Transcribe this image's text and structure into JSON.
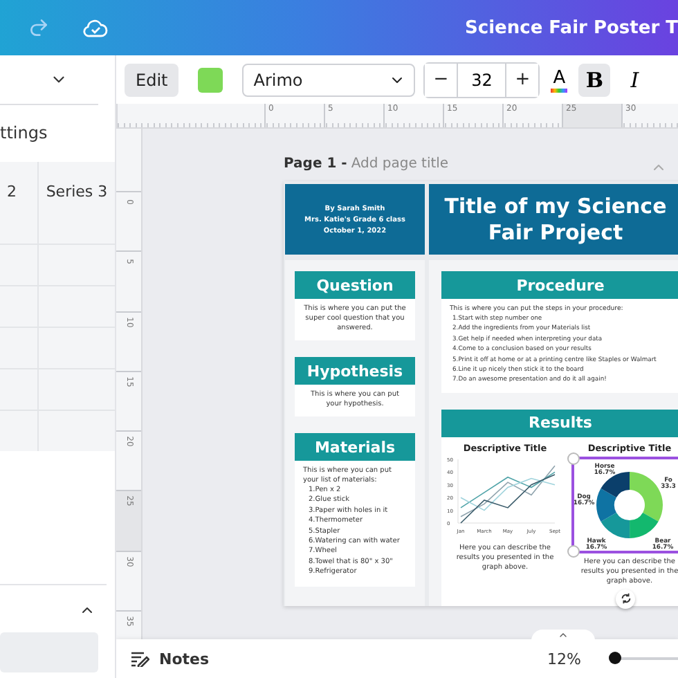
{
  "header": {
    "title": "Science Fair Poster T"
  },
  "left_panel": {
    "settings_label": "ttings",
    "table": {
      "columns": [
        "2",
        "Series 3"
      ]
    }
  },
  "toolbar": {
    "edit": "Edit",
    "color": "#7ed957",
    "font": "Arimo",
    "decrease": "−",
    "size": "32",
    "increase": "+",
    "text_color": "A",
    "styles": [
      {
        "label": "B",
        "kind": "bold",
        "selected": true
      },
      {
        "label": "I",
        "kind": "italic",
        "selected": false
      }
    ]
  },
  "rulers": {
    "horizontal": [
      "0",
      "5",
      "10",
      "15",
      "20",
      "25",
      "30"
    ],
    "vertical": [
      "0",
      "5",
      "10",
      "15",
      "20",
      "25",
      "30",
      "35"
    ]
  },
  "page": {
    "label": "Page 1 -",
    "title_placeholder": "Add page title"
  },
  "poster": {
    "byline": [
      "By Sarah Smith",
      "Mrs. Katie's Grade 6 class",
      "October 1, 2022"
    ],
    "title": "Title of my Science Fair Project",
    "left_sections": [
      {
        "heading": "Question",
        "text": "This is where you can put the super cool question that you answered."
      },
      {
        "heading": "Hypothesis",
        "text": "This is where you can put your hypothesis."
      },
      {
        "heading": "Materials",
        "text": "This is where you can put your list of materials:",
        "items": [
          "1.Pen x 2",
          "2.Glue stick",
          "3.Paper with holes in it",
          "4.Thermometer",
          "5.Stapler",
          "6.Watering can with water",
          "7.Wheel",
          "8.Towel that is 80\" x 30\"",
          "9.Refrigerator"
        ]
      }
    ],
    "procedure": {
      "heading": "Procedure",
      "text": "This is where you can put the steps in your procedure:",
      "items": [
        "1.Start with step number one",
        "2.Add the ingredients from your Materials list",
        "3.Get help if needed when interpreting your data",
        "4.Come to a conclusion based on your results",
        "5.Print it off at home or at a printing centre like Staples or Walmart",
        "6.Line it up nicely then stick it to the board",
        "7.Do an awesome presentation and do it all again!"
      ]
    },
    "results": {
      "heading": "Results",
      "charts": [
        {
          "caption": "Here you can describe the results you presented in the graph above.",
          "chart_data": {
            "type": "line",
            "title": "Descriptive Title",
            "categories": [
              "Jan",
              "March",
              "May",
              "July",
              "Sept"
            ],
            "ylim": [
              0,
              50
            ],
            "yticks": [
              0,
              10,
              20,
              30,
              40,
              50
            ],
            "series": [
              {
                "color": "#8fa3ad",
                "values": [
                  5,
                  15,
                  32,
                  22,
                  45
                ]
              },
              {
                "color": "#4fa3a8",
                "values": [
                  12,
                  24,
                  36,
                  28,
                  40
                ]
              },
              {
                "color": "#9fd3dc",
                "values": [
                  20,
                  10,
                  28,
                  35,
                  30
                ]
              },
              {
                "color": "#3b5c6b",
                "values": [
                  0,
                  18,
                  12,
                  30,
                  38
                ]
              }
            ]
          }
        },
        {
          "caption": "Here you can describe the results you presented in the graph above.",
          "selected": true,
          "chart_data": {
            "type": "donut",
            "title": "Descriptive Title",
            "categories": [
              "Fo",
              "Bear",
              "Hawk",
              "Dog",
              "Horse"
            ],
            "values": [
              33.3,
              16.7,
              16.7,
              16.7,
              16.7
            ],
            "value_labels": [
              "33.3",
              "16.7%",
              "16.7%",
              "16.7%",
              "16.7%"
            ]
          }
        }
      ]
    }
  },
  "bottom_bar": {
    "notes": "Notes",
    "zoom": "12%",
    "zoom_level": {
      "level": 0.05
    }
  }
}
